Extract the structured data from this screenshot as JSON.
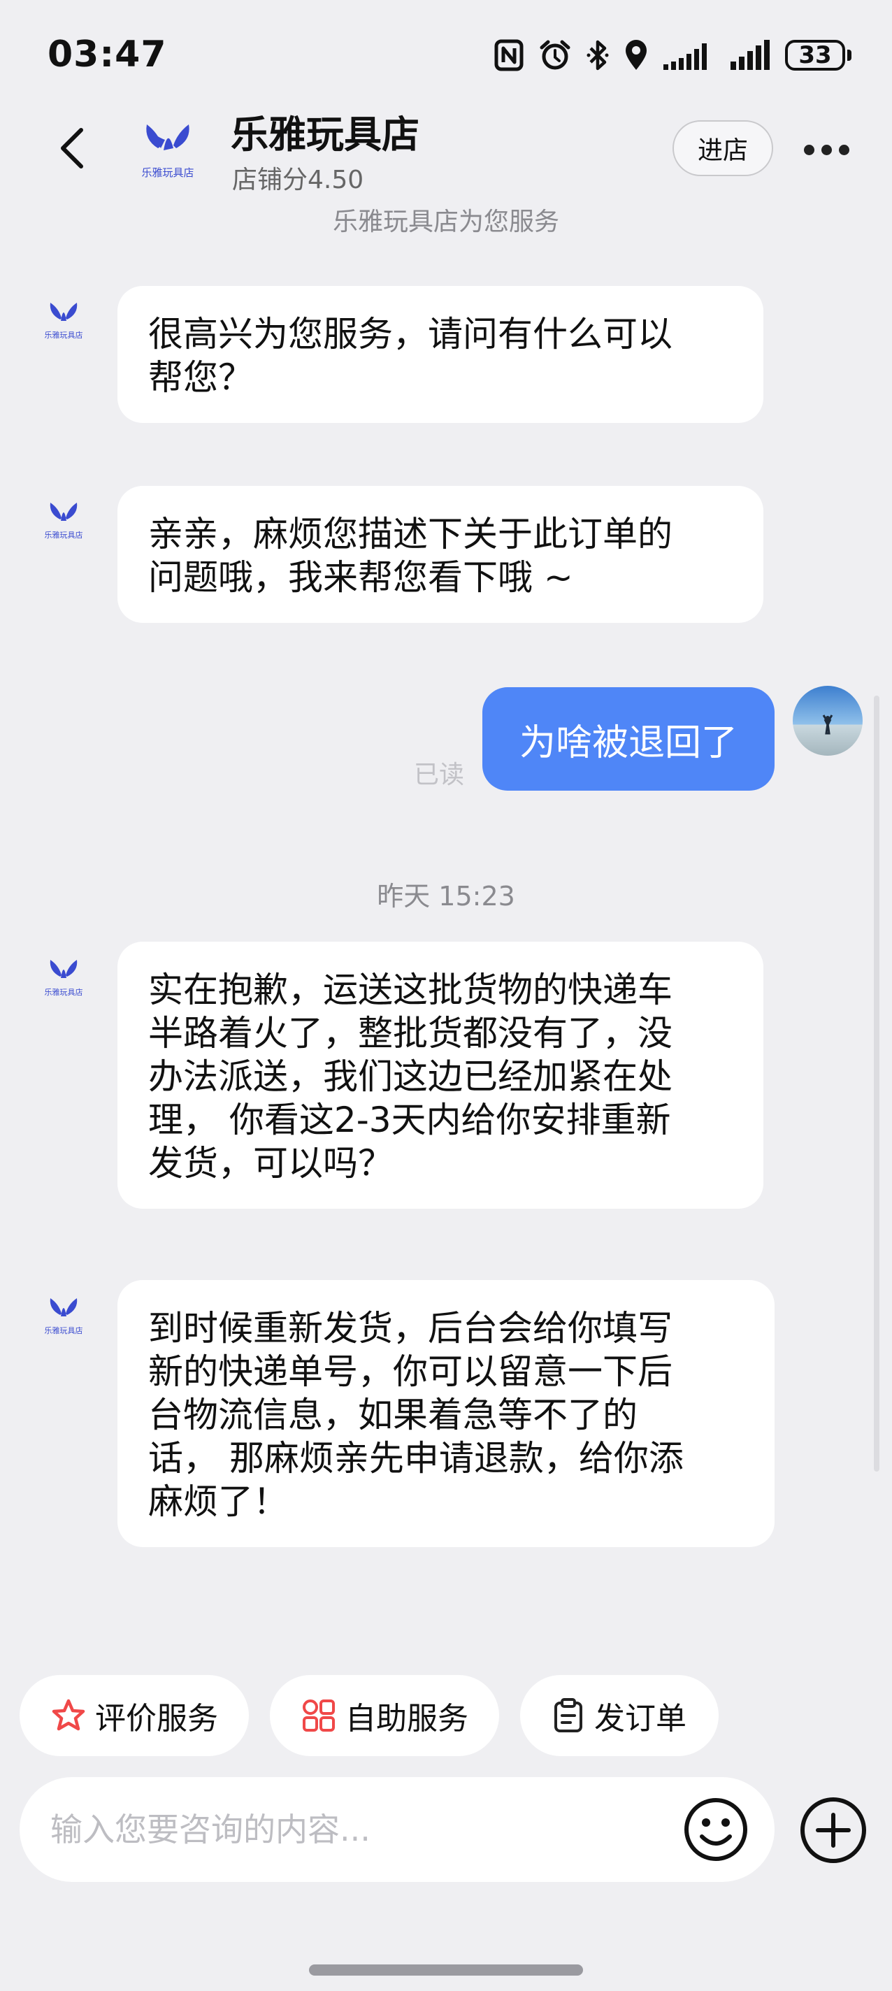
{
  "status_bar": {
    "time": "03:47",
    "battery": "33",
    "icons": [
      "nfc-icon",
      "alarm-icon",
      "bluetooth-icon",
      "location-icon",
      "signal-icon",
      "signal-icon",
      "battery-icon"
    ]
  },
  "header": {
    "back_icon": "chevron-left-icon",
    "logo_text": "乐雅玩具店",
    "shop_name": "乐雅玩具店",
    "rating": "店铺分4.50",
    "enter_store_label": "进店",
    "more_icon": "more-dots-icon",
    "service_notice": "乐雅玩具店为您服务"
  },
  "chat": {
    "messages": [
      {
        "from": "shop",
        "text": "很高兴为您服务，请问有什么可以\n帮您？"
      },
      {
        "from": "shop",
        "text": "亲亲，麻烦您描述下关于此订单的\n问题哦，我来帮您看下哦 ~"
      },
      {
        "from": "user",
        "text": "为啥被退回了",
        "read_status": "已读"
      },
      {
        "timestamp": "昨天 15:23"
      },
      {
        "from": "shop",
        "text": "实在抱歉，运送这批货物的快递车\n半路着火了，整批货都没有了，没\n办法派送，我们这边已经加紧在处\n理， 你看这2-3天内给你安排重新\n发货，可以吗？"
      },
      {
        "from": "shop",
        "text": "到时候重新发货，后台会给你填写\n新的快递单号，你可以留意一下后\n台物流信息，如果着急等不了的\n话， 那麻烦亲先申请退款，给你添\n麻烦了！"
      }
    ]
  },
  "quick_actions": [
    {
      "label": "评价服务",
      "icon": "star-icon",
      "color": "#f04848"
    },
    {
      "label": "自助服务",
      "icon": "grid-icon",
      "color": "#f04848"
    },
    {
      "label": "发订单",
      "icon": "clipboard-icon",
      "color": "#222222"
    }
  ],
  "input": {
    "placeholder": "输入您要咨询的内容...",
    "emoji_icon": "smiley-icon",
    "plus_icon": "plus-circle-icon"
  },
  "colors": {
    "accent": "#4f86f7",
    "logo": "#3a4bd0",
    "background": "#efeff2"
  }
}
